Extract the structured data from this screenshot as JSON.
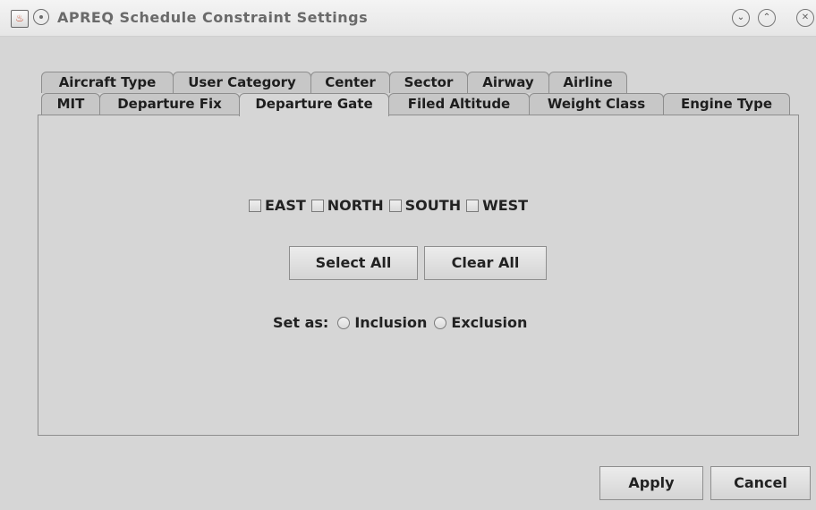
{
  "window": {
    "title": "APREQ Schedule Constraint Settings",
    "icons": [
      "java-icon",
      "pin-icon",
      "minimize-icon",
      "maximize-icon",
      "close-icon"
    ]
  },
  "tabs": {
    "row1": [
      "Aircraft Type",
      "User Category",
      "Center",
      "Sector",
      "Airway",
      "Airline"
    ],
    "row2": [
      "MIT",
      "Departure Fix",
      "Departure Gate",
      "Filed Altitude",
      "Weight Class",
      "Engine Type"
    ],
    "selected": "Departure Gate"
  },
  "gates": [
    {
      "label": "EAST",
      "checked": false
    },
    {
      "label": "NORTH",
      "checked": false
    },
    {
      "label": "SOUTH",
      "checked": false
    },
    {
      "label": "WEST",
      "checked": false
    }
  ],
  "actions": {
    "select_all": "Select All",
    "clear_all": "Clear All"
  },
  "set_as": {
    "label": "Set as:",
    "options": [
      "Inclusion",
      "Exclusion"
    ],
    "selected": null
  },
  "footer": {
    "apply": "Apply",
    "cancel": "Cancel"
  }
}
